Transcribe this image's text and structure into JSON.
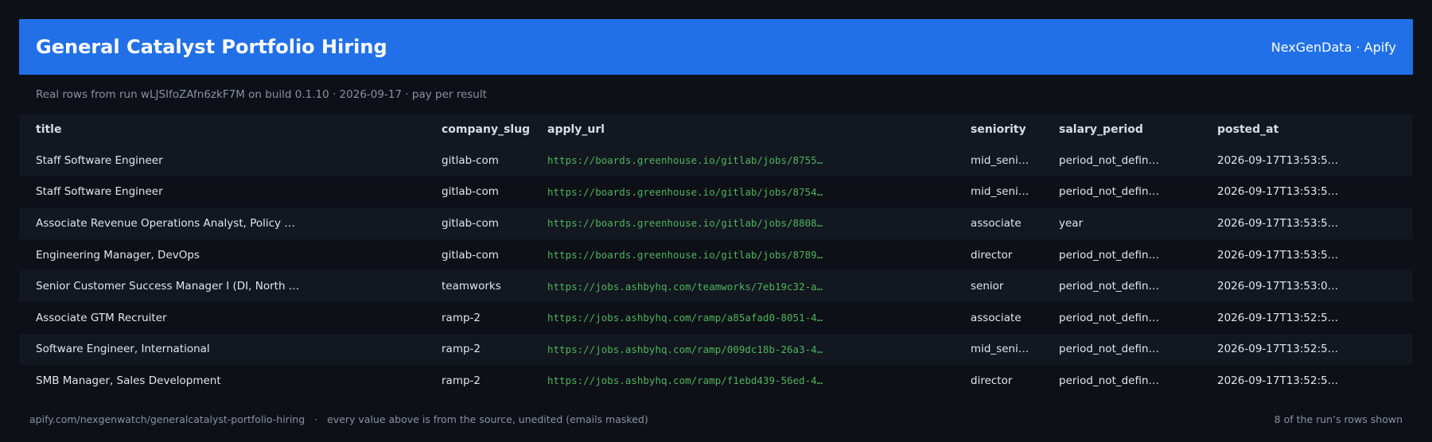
{
  "header": {
    "title": "General Catalyst Portfolio Hiring",
    "brand": "NexGenData · Apify"
  },
  "subtitle": "Real rows from run wLJSIfoZAfn6zkF7M on build 0.1.10 · 2026-09-17 · pay per result",
  "columns": [
    "title",
    "company_slug",
    "apply_url",
    "seniority",
    "salary_period",
    "posted_at"
  ],
  "rows": [
    {
      "title": "Staff Software Engineer",
      "company_slug": "gitlab-com",
      "apply_url": "https://boards.greenhouse.io/gitlab/jobs/8755…",
      "seniority": "mid_seni…",
      "salary_period": "period_not_defin…",
      "posted_at": "2026-09-17T13:53:5…"
    },
    {
      "title": "Staff Software Engineer",
      "company_slug": "gitlab-com",
      "apply_url": "https://boards.greenhouse.io/gitlab/jobs/8754…",
      "seniority": "mid_seni…",
      "salary_period": "period_not_defin…",
      "posted_at": "2026-09-17T13:53:5…"
    },
    {
      "title": "Associate Revenue Operations Analyst, Policy …",
      "company_slug": "gitlab-com",
      "apply_url": "https://boards.greenhouse.io/gitlab/jobs/8808…",
      "seniority": "associate",
      "salary_period": "year",
      "posted_at": "2026-09-17T13:53:5…"
    },
    {
      "title": "Engineering Manager, DevOps",
      "company_slug": "gitlab-com",
      "apply_url": "https://boards.greenhouse.io/gitlab/jobs/8789…",
      "seniority": "director",
      "salary_period": "period_not_defin…",
      "posted_at": "2026-09-17T13:53:5…"
    },
    {
      "title": "Senior Customer Success Manager I (DI, North …",
      "company_slug": "teamworks",
      "apply_url": "https://jobs.ashbyhq.com/teamworks/7eb19c32-a…",
      "seniority": "senior",
      "salary_period": "period_not_defin…",
      "posted_at": "2026-09-17T13:53:0…"
    },
    {
      "title": "Associate GTM Recruiter",
      "company_slug": "ramp-2",
      "apply_url": "https://jobs.ashbyhq.com/ramp/a85afad0-8051-4…",
      "seniority": "associate",
      "salary_period": "period_not_defin…",
      "posted_at": "2026-09-17T13:52:5…"
    },
    {
      "title": "Software Engineer, International",
      "company_slug": "ramp-2",
      "apply_url": "https://jobs.ashbyhq.com/ramp/009dc18b-26a3-4…",
      "seniority": "mid_seni…",
      "salary_period": "period_not_defin…",
      "posted_at": "2026-09-17T13:52:5…"
    },
    {
      "title": "SMB Manager, Sales Development",
      "company_slug": "ramp-2",
      "apply_url": "https://jobs.ashbyhq.com/ramp/f1ebd439-56ed-4…",
      "seniority": "director",
      "salary_period": "period_not_defin…",
      "posted_at": "2026-09-17T13:52:5…"
    }
  ],
  "footer": {
    "url": "apify.com/nexgenwatch/generalcatalyst-portfolio-hiring",
    "separator": "·",
    "note": "every value above is from the source, unedited (emails masked)",
    "count": "8 of the run’s rows shown"
  },
  "colors": {
    "header_bg": "#2170e8",
    "page_bg": "#0d1017",
    "url_text": "#4fb35c"
  }
}
